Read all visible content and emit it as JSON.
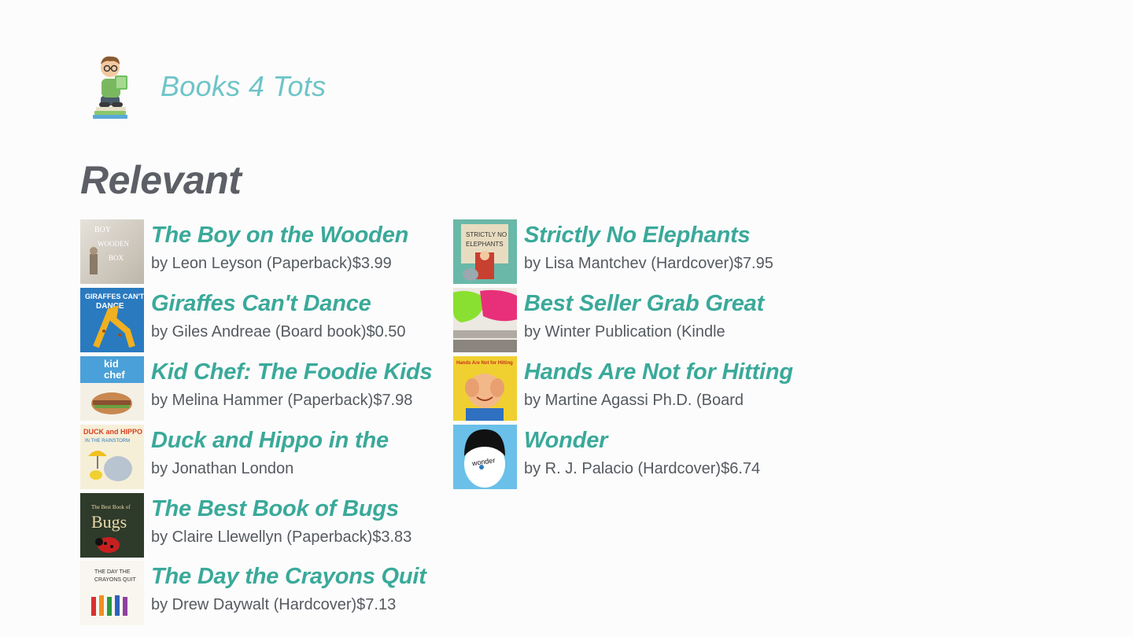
{
  "app": {
    "title": "Books 4 Tots",
    "logo_icon": "reading-boy-logo-icon"
  },
  "section": {
    "title": "Relevant"
  },
  "colors": {
    "accent": "#3aa99a",
    "app_title": "#6ec4c8",
    "heading": "#5c5f66",
    "byline": "#555a60",
    "background": "#fcfcfc"
  },
  "books": [
    {
      "title": "The Boy on the Wooden Box: How the Impossible Became Possible",
      "byline": "by Leon Leyson (Paperback)$3.99",
      "cover_icon": "boy-on-wooden-box-cover"
    },
    {
      "title": "Giraffes Can't Dance",
      "byline": "by Giles Andreae (Board book)$0.50",
      "cover_icon": "giraffes-cant-dance-cover"
    },
    {
      "title": "Kid Chef: The Foodie Kids Cookbook: Healthy",
      "byline": "by Melina Hammer (Paperback)$7.98",
      "cover_icon": "kid-chef-cover"
    },
    {
      "title": "Duck and Hippo in the Rainstorm (Duck and",
      "byline": "by Jonathan London",
      "cover_icon": "duck-and-hippo-cover"
    },
    {
      "title": "The Best Book of Bugs",
      "byline": "by Claire Llewellyn (Paperback)$3.83",
      "cover_icon": "best-book-of-bugs-cover"
    },
    {
      "title": "The Day the Crayons Quit",
      "byline": "by Drew Daywalt (Hardcover)$7.13",
      "cover_icon": "day-the-crayons-quit-cover"
    },
    {
      "title": "Strictly No Elephants",
      "byline": "by Lisa Mantchev (Hardcover)$7.95",
      "cover_icon": "strictly-no-elephants-cover"
    },
    {
      "title": "Best Seller Grab Great Books: Puzzle for Everyone",
      "byline": "by Winter Publication (Kindle",
      "cover_icon": "yarn-skeins-cover"
    },
    {
      "title": "Hands Are Not for Hitting (Board Book)",
      "byline": "by Martine Agassi Ph.D. (Board",
      "cover_icon": "hands-are-not-for-hitting-cover"
    },
    {
      "title": "Wonder",
      "byline": "by R. J. Palacio (Hardcover)$6.74",
      "cover_icon": "wonder-cover"
    }
  ]
}
